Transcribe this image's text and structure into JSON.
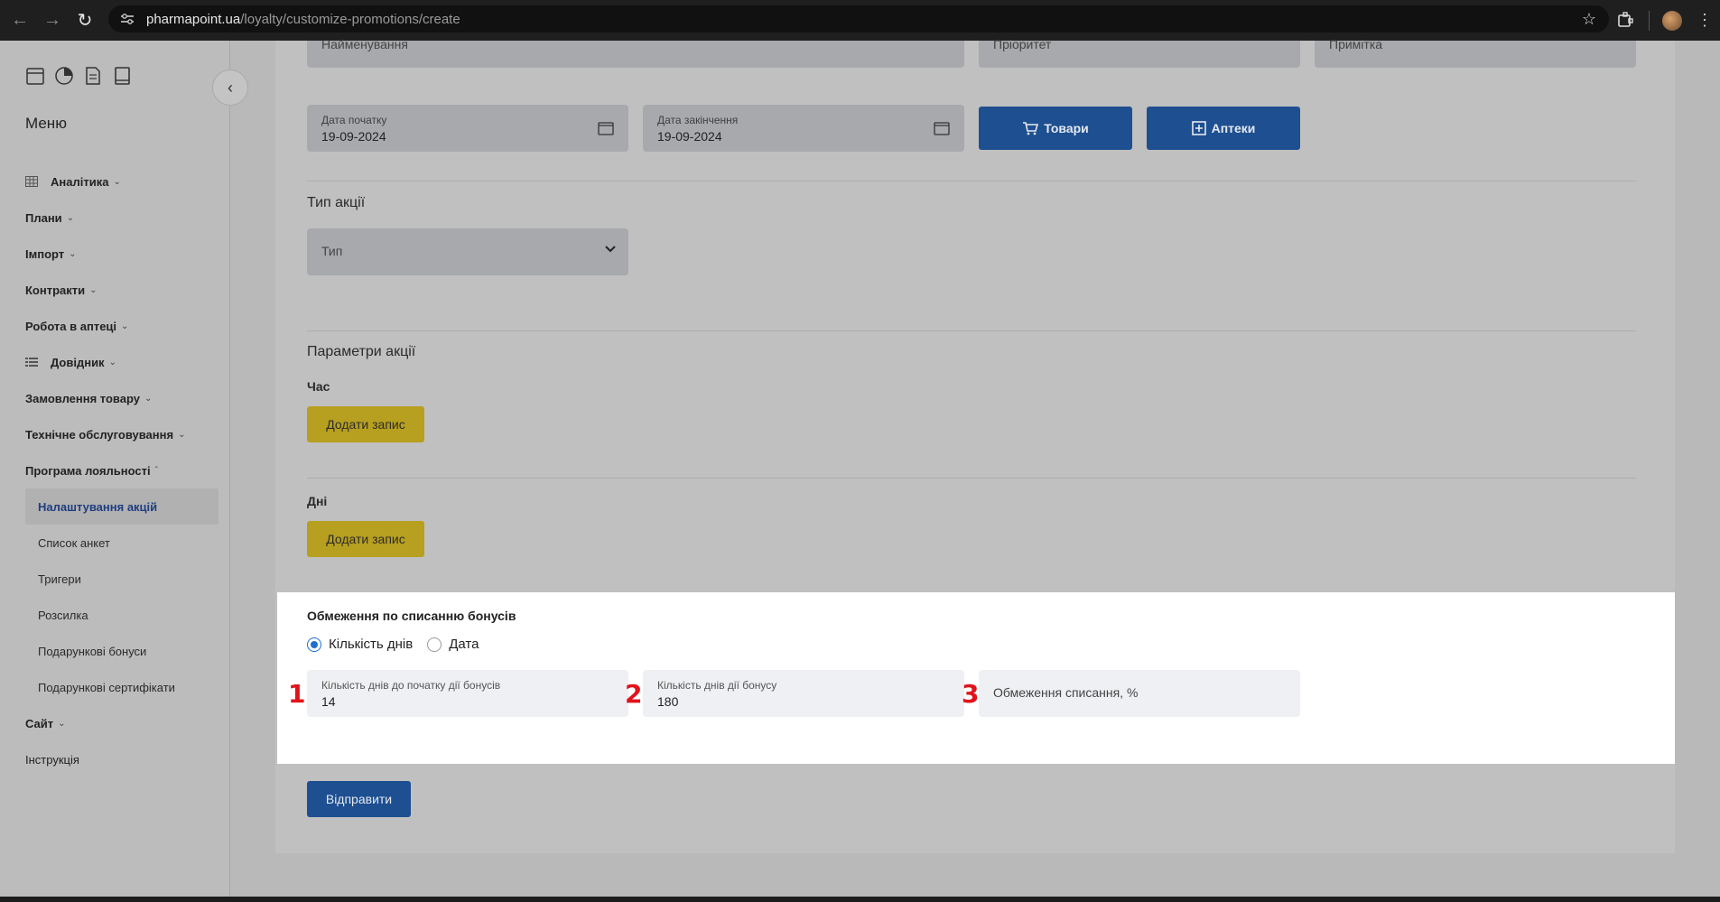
{
  "browser": {
    "url_host": "pharmapoint.ua",
    "url_path": "/loyalty/customize-promotions/create"
  },
  "sidebar": {
    "menu_title": "Меню",
    "items": [
      {
        "label": "Аналітика",
        "icon": "grid-icon"
      },
      {
        "label": "Плани"
      },
      {
        "label": "Імпорт"
      },
      {
        "label": "Контракти"
      },
      {
        "label": "Робота в аптеці"
      },
      {
        "label": "Довідник",
        "icon": "list-icon"
      },
      {
        "label": "Замовлення товару"
      },
      {
        "label": "Технічне обслуговування"
      },
      {
        "label": "Програма лояльності"
      }
    ],
    "sub_items": [
      {
        "label": "Налаштування акцій",
        "active": true
      },
      {
        "label": "Список анкет"
      },
      {
        "label": "Тригери"
      },
      {
        "label": "Розсилка"
      },
      {
        "label": "Подарункові бонуси"
      },
      {
        "label": "Подарункові сертифікати"
      }
    ],
    "after_items": [
      {
        "label": "Сайт"
      },
      {
        "label": "Інструкція"
      }
    ]
  },
  "form": {
    "top_row": {
      "name_placeholder": "Найменування",
      "priority_placeholder": "Пріоритет",
      "note_placeholder": "Примітка"
    },
    "start_date": {
      "label": "Дата початку",
      "value": "19-09-2024"
    },
    "end_date": {
      "label": "Дата закінчення",
      "value": "19-09-2024"
    },
    "goods_button": "Товари",
    "pharmacies_button": "Аптеки",
    "type_section": {
      "title": "Тип акції",
      "select_placeholder": "Тип"
    },
    "params_section": {
      "title": "Параметри акції",
      "time_label": "Час",
      "time_add": "Додати запис",
      "days_label": "Дні",
      "days_add": "Додати запис"
    },
    "bonus_limits": {
      "title": "Обмеження по списанню бонусів",
      "radio_days": "Кількість днів",
      "radio_date": "Дата",
      "selected": "days",
      "days_before_start": {
        "label": "Кількість днів до початку дії бонусів",
        "value": "14",
        "marker": "1"
      },
      "bonus_days": {
        "label": "Кількість днів дії бонусу",
        "value": "180",
        "marker": "2"
      },
      "limit_percent": {
        "placeholder": "Обмеження списання, %",
        "marker": "3"
      }
    },
    "submit_button": "Відправити"
  }
}
